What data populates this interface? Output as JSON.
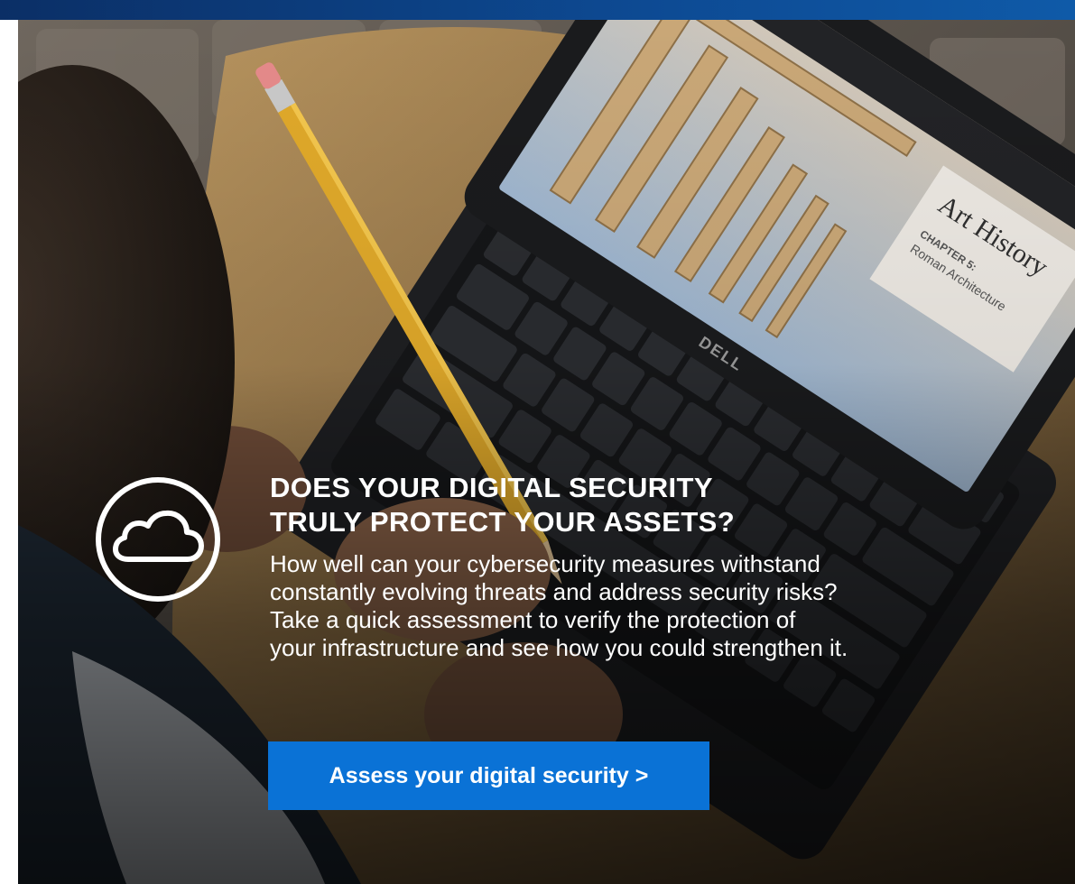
{
  "hero": {
    "headline_lines": [
      "DOES YOUR DIGITAL SECURITY",
      "TRULY PROTECT YOUR ASSETS?"
    ],
    "body_lines": [
      "How well can your cybersecurity measures withstand",
      "constantly evolving threats and address security risks?",
      "Take a quick assessment to verify the protection of",
      "your infrastructure and see how you could strengthen it."
    ],
    "cta_label": "Assess your digital security >",
    "badge_icon": "cloud-icon",
    "photo_text": {
      "screen_title": "Art History",
      "screen_chapter": "CHAPTER 5:",
      "screen_subtitle": "Roman Architecture",
      "laptop_brand": "DELL"
    }
  },
  "colors": {
    "top_bar": "#0d4a93",
    "cta_background": "#0a72d6",
    "text": "#ffffff"
  }
}
